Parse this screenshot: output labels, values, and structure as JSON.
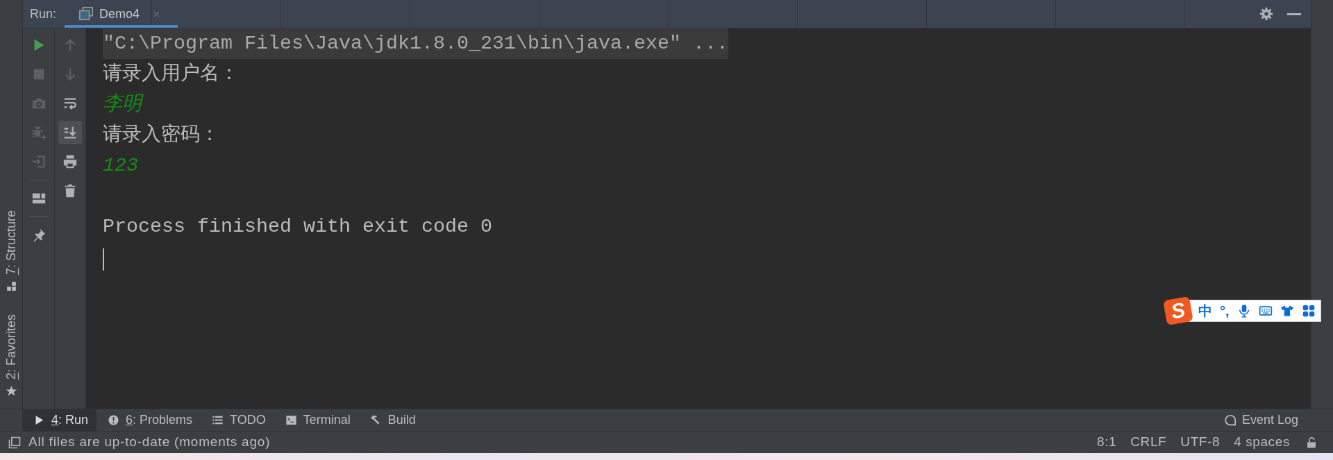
{
  "run_panel": {
    "label": "Run:",
    "tabs": [
      {
        "title": "Demo4",
        "selected": true
      }
    ]
  },
  "toolbar_main": [
    {
      "kind": "run",
      "disabled": false
    },
    {
      "kind": "stop",
      "disabled": true
    },
    {
      "kind": "camera",
      "disabled": true
    },
    {
      "kind": "debug",
      "disabled": true
    },
    {
      "kind": "exit",
      "disabled": true
    },
    {
      "kind": "separator"
    },
    {
      "kind": "layout",
      "disabled": false
    },
    {
      "kind": "separator"
    },
    {
      "kind": "pin",
      "disabled": false
    }
  ],
  "toolbar_console": [
    {
      "kind": "up",
      "disabled": true,
      "on": false
    },
    {
      "kind": "down",
      "disabled": true,
      "on": false
    },
    {
      "kind": "wrap",
      "disabled": false,
      "on": false
    },
    {
      "kind": "scroll-end",
      "disabled": false,
      "on": true
    },
    {
      "kind": "print",
      "disabled": false,
      "on": false
    },
    {
      "kind": "trash",
      "disabled": false,
      "on": false
    }
  ],
  "console": [
    {
      "kind": "command",
      "text": "\"C:\\Program Files\\Java\\jdk1.8.0_231\\bin\\java.exe\" ..."
    },
    {
      "kind": "output",
      "text": "请录入用户名："
    },
    {
      "kind": "input",
      "text": "李明"
    },
    {
      "kind": "output",
      "text": "请录入密码："
    },
    {
      "kind": "input",
      "text": "123"
    },
    {
      "kind": "blank"
    },
    {
      "kind": "output",
      "text": "Process finished with exit code 0"
    },
    {
      "kind": "caret"
    }
  ],
  "left_stripe": [
    {
      "kind": "structure",
      "label": "7: Structure",
      "mnemonic": true,
      "selected": false
    },
    {
      "kind": "favorites",
      "label": "2: Favorites",
      "mnemonic": true,
      "selected": false
    }
  ],
  "bottom_tabs": [
    {
      "kind": "run",
      "label": "4: Run",
      "mnemonic": true,
      "selected": true
    },
    {
      "kind": "problems",
      "label": "6: Problems",
      "mnemonic": true,
      "selected": false
    },
    {
      "kind": "todo",
      "label": "TODO",
      "mnemonic": false,
      "selected": false
    },
    {
      "kind": "terminal",
      "label": "Terminal",
      "mnemonic": false,
      "selected": false
    },
    {
      "kind": "build",
      "label": "Build",
      "mnemonic": false,
      "selected": false
    }
  ],
  "event_log": {
    "label": "Event Log"
  },
  "status_bar": {
    "message": "All files are up-to-date (moments ago)",
    "widgets": [
      "8:1",
      "CRLF",
      "UTF-8",
      "4 spaces"
    ]
  },
  "input_method": {
    "logo": "S",
    "mode": "中",
    "punctuation": "°,"
  }
}
